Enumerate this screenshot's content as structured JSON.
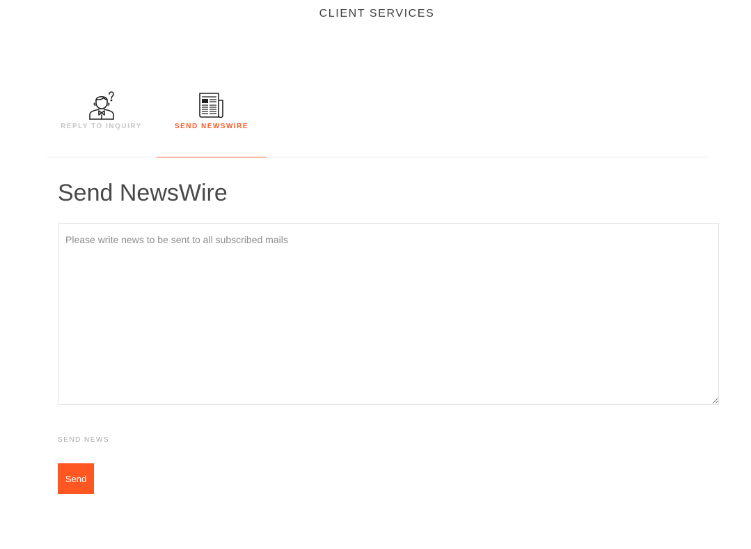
{
  "header": {
    "title": "CLIENT SERVICES"
  },
  "tabs": [
    {
      "label": "REPLY TO INQUIRY",
      "icon": "customer-question-icon",
      "active": false
    },
    {
      "label": "SEND NEWSWIRE",
      "icon": "newspaper-icon",
      "active": true
    }
  ],
  "main": {
    "heading": "Send NewsWire",
    "textarea": {
      "value": "",
      "placeholder": "Please write news to be sent to all subscribed mails"
    },
    "field_label": "SEND NEWS",
    "send_label": "Send"
  },
  "colors": {
    "accent": "#ff5722",
    "inactive_tab": "#c5c5c5",
    "heading": "#494949",
    "border": "#e2e2e2"
  }
}
